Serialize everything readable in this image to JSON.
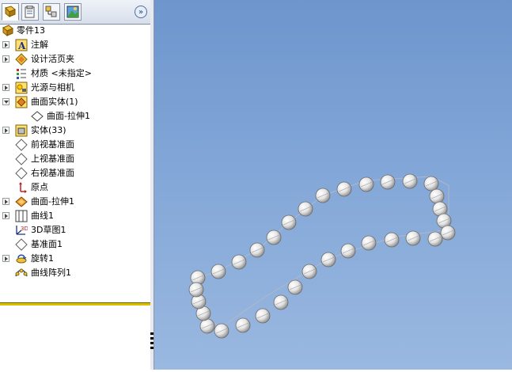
{
  "feature_tree": {
    "root": {
      "label": "零件13",
      "icon": "part-icon"
    },
    "items": [
      {
        "label": "注解",
        "icon": "annotation-icon",
        "expander": "collapsed"
      },
      {
        "label": "设计活页夹",
        "icon": "design-binder-icon",
        "expander": "collapsed"
      },
      {
        "label": "材质 <未指定>",
        "icon": "material-icon",
        "expander": "none"
      },
      {
        "label": "光源与相机",
        "icon": "lights-cameras-icon",
        "expander": "collapsed"
      },
      {
        "label": "曲面实体(1)",
        "icon": "surface-bodies-folder-icon",
        "expander": "expanded"
      },
      {
        "label": "曲面-拉伸1",
        "icon": "surface-body-icon",
        "expander": "none",
        "indent": 1
      },
      {
        "label": "实体(33)",
        "icon": "solid-bodies-folder-icon",
        "expander": "collapsed"
      },
      {
        "label": "前视基准面",
        "icon": "plane-icon",
        "expander": "none"
      },
      {
        "label": "上视基准面",
        "icon": "plane-icon",
        "expander": "none"
      },
      {
        "label": "右视基准面",
        "icon": "plane-icon",
        "expander": "none"
      },
      {
        "label": "原点",
        "icon": "origin-icon",
        "expander": "none"
      },
      {
        "label": "曲面-拉伸1",
        "icon": "surface-extrude-icon",
        "expander": "collapsed"
      },
      {
        "label": "曲线1",
        "icon": "curve-icon",
        "expander": "collapsed"
      },
      {
        "label": "3D草图1",
        "icon": "3d-sketch-icon",
        "expander": "none"
      },
      {
        "label": "基准面1",
        "icon": "plane-icon",
        "expander": "none"
      },
      {
        "label": "旋转1",
        "icon": "revolve-icon",
        "expander": "collapsed"
      },
      {
        "label": "曲线阵列1",
        "icon": "curve-pattern-icon",
        "expander": "none"
      }
    ]
  },
  "panel_tabs": [
    "feature-manager-tab-icon",
    "property-manager-tab-icon",
    "configuration-manager-tab-icon",
    "display-manager-tab-icon"
  ],
  "expand_button_glyph": "»",
  "viewport": {
    "background_top": "#6e96cd",
    "background_bottom": "#9ab8e0",
    "spheres_count": 33
  }
}
